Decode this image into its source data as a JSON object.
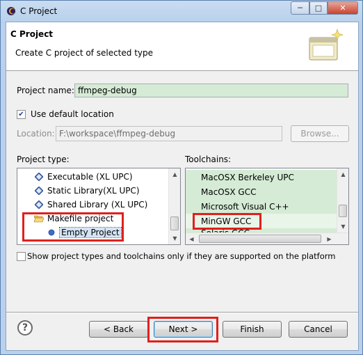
{
  "window": {
    "title": "C Project"
  },
  "banner": {
    "title": "C Project",
    "subtitle": "Create C project of selected type"
  },
  "project_name": {
    "label": "Project name:",
    "value": "ffmpeg-debug"
  },
  "use_default_location": {
    "label": "Use default location",
    "checked": true
  },
  "location": {
    "label": "Location:",
    "value": "F:\\workspace\\ffmpeg-debug",
    "browse_label": "Browse..."
  },
  "project_type": {
    "label": "Project type:",
    "items": [
      {
        "label": "Executable (XL UPC)",
        "icon": "diamond-icon"
      },
      {
        "label": "Static Library(XL UPC)",
        "icon": "diamond-icon"
      },
      {
        "label": "Shared Library (XL UPC)",
        "icon": "diamond-icon"
      },
      {
        "label": "Makefile project",
        "icon": "open-folder-icon"
      },
      {
        "label": "Empty Project",
        "icon": "bullet-icon",
        "selected": true
      }
    ]
  },
  "toolchains": {
    "label": "Toolchains:",
    "items": [
      {
        "label": "MacOSX Berkeley UPC"
      },
      {
        "label": "MacOSX GCC"
      },
      {
        "label": "Microsoft Visual C++"
      },
      {
        "label": "MinGW GCC",
        "selected": true
      },
      {
        "label": "Solaris GCC"
      }
    ]
  },
  "filter": {
    "label": "Show project types and toolchains only if they are supported on the platform",
    "checked": false
  },
  "buttons": {
    "back": "< Back",
    "next": "Next >",
    "finish": "Finish",
    "cancel": "Cancel"
  },
  "colors": {
    "highlight": "#e0201c",
    "field_bg": "#d5ebd5",
    "window_frame": "#b9d1ec"
  }
}
